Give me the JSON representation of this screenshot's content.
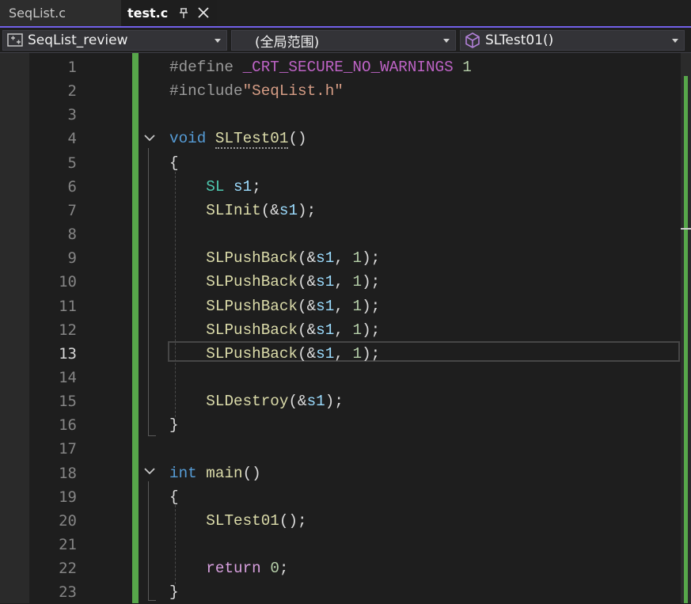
{
  "tabs": [
    {
      "label": "SeqList.c",
      "active": false
    },
    {
      "label": "test.c",
      "active": true
    }
  ],
  "navbar": {
    "project": "SeqList_review",
    "scope": "(全局范围)",
    "function": "SLTest01()"
  },
  "editor": {
    "current_line": 13,
    "line_numbers": [
      "1",
      "2",
      "3",
      "4",
      "5",
      "6",
      "7",
      "8",
      "9",
      "10",
      "11",
      "12",
      "13",
      "14",
      "15",
      "16",
      "17",
      "18",
      "19",
      "20",
      "21",
      "22",
      "23"
    ],
    "lines": [
      {
        "tokens": [
          [
            "pp",
            "#define "
          ],
          [
            "macro",
            "_CRT_SECURE_NO_WARNINGS"
          ],
          [
            "num",
            " 1"
          ]
        ]
      },
      {
        "tokens": [
          [
            "pp",
            "#include"
          ],
          [
            "str",
            "\"SeqList.h\""
          ]
        ]
      },
      {
        "tokens": []
      },
      {
        "tokens": [
          [
            "kw",
            "void"
          ],
          [
            "plain",
            " "
          ],
          [
            "fn",
            "SLTest01"
          ],
          [
            "plain",
            "()"
          ]
        ]
      },
      {
        "tokens": [
          [
            "plain",
            "{"
          ]
        ]
      },
      {
        "tokens": [
          [
            "plain",
            "    "
          ],
          [
            "type",
            "SL"
          ],
          [
            "plain",
            " "
          ],
          [
            "var",
            "s1"
          ],
          [
            "plain",
            ";"
          ]
        ]
      },
      {
        "tokens": [
          [
            "plain",
            "    "
          ],
          [
            "fn",
            "SLInit"
          ],
          [
            "plain",
            "(&"
          ],
          [
            "var",
            "s1"
          ],
          [
            "plain",
            ");"
          ]
        ]
      },
      {
        "tokens": []
      },
      {
        "tokens": [
          [
            "plain",
            "    "
          ],
          [
            "fn",
            "SLPushBack"
          ],
          [
            "plain",
            "(&"
          ],
          [
            "var",
            "s1"
          ],
          [
            "plain",
            ", "
          ],
          [
            "num",
            "1"
          ],
          [
            "plain",
            ");"
          ]
        ]
      },
      {
        "tokens": [
          [
            "plain",
            "    "
          ],
          [
            "fn",
            "SLPushBack"
          ],
          [
            "plain",
            "(&"
          ],
          [
            "var",
            "s1"
          ],
          [
            "plain",
            ", "
          ],
          [
            "num",
            "1"
          ],
          [
            "plain",
            ");"
          ]
        ]
      },
      {
        "tokens": [
          [
            "plain",
            "    "
          ],
          [
            "fn",
            "SLPushBack"
          ],
          [
            "plain",
            "(&"
          ],
          [
            "var",
            "s1"
          ],
          [
            "plain",
            ", "
          ],
          [
            "num",
            "1"
          ],
          [
            "plain",
            ");"
          ]
        ]
      },
      {
        "tokens": [
          [
            "plain",
            "    "
          ],
          [
            "fn",
            "SLPushBack"
          ],
          [
            "plain",
            "(&"
          ],
          [
            "var",
            "s1"
          ],
          [
            "plain",
            ", "
          ],
          [
            "num",
            "1"
          ],
          [
            "plain",
            ");"
          ]
        ]
      },
      {
        "tokens": [
          [
            "plain",
            "    "
          ],
          [
            "fn",
            "SLPushBack"
          ],
          [
            "plain",
            "(&"
          ],
          [
            "var",
            "s1"
          ],
          [
            "plain",
            ", "
          ],
          [
            "num",
            "1"
          ],
          [
            "plain",
            ");"
          ]
        ]
      },
      {
        "tokens": []
      },
      {
        "tokens": [
          [
            "plain",
            "    "
          ],
          [
            "fn",
            "SLDestroy"
          ],
          [
            "plain",
            "(&"
          ],
          [
            "var",
            "s1"
          ],
          [
            "plain",
            ");"
          ]
        ]
      },
      {
        "tokens": [
          [
            "plain",
            "}"
          ]
        ]
      },
      {
        "tokens": []
      },
      {
        "tokens": [
          [
            "kw",
            "int"
          ],
          [
            "plain",
            " "
          ],
          [
            "fn",
            "main"
          ],
          [
            "plain",
            "()"
          ]
        ]
      },
      {
        "tokens": [
          [
            "plain",
            "{"
          ]
        ]
      },
      {
        "tokens": [
          [
            "plain",
            "    "
          ],
          [
            "fn",
            "SLTest01"
          ],
          [
            "plain",
            "();"
          ]
        ]
      },
      {
        "tokens": []
      },
      {
        "tokens": [
          [
            "plain",
            "    "
          ],
          [
            "ctl",
            "return"
          ],
          [
            "plain",
            " "
          ],
          [
            "num",
            "0"
          ],
          [
            "plain",
            ";"
          ]
        ]
      },
      {
        "tokens": [
          [
            "plain",
            "}"
          ]
        ]
      }
    ]
  },
  "colors": {
    "accent": "#7160e8",
    "change_marker": "#57a64a",
    "background": "#1e1e1e"
  },
  "icons": {
    "pin": "pin-icon",
    "close": "close-icon",
    "project": "project-icon",
    "function": "function-cube-icon",
    "fold": "chevron-down-icon"
  }
}
